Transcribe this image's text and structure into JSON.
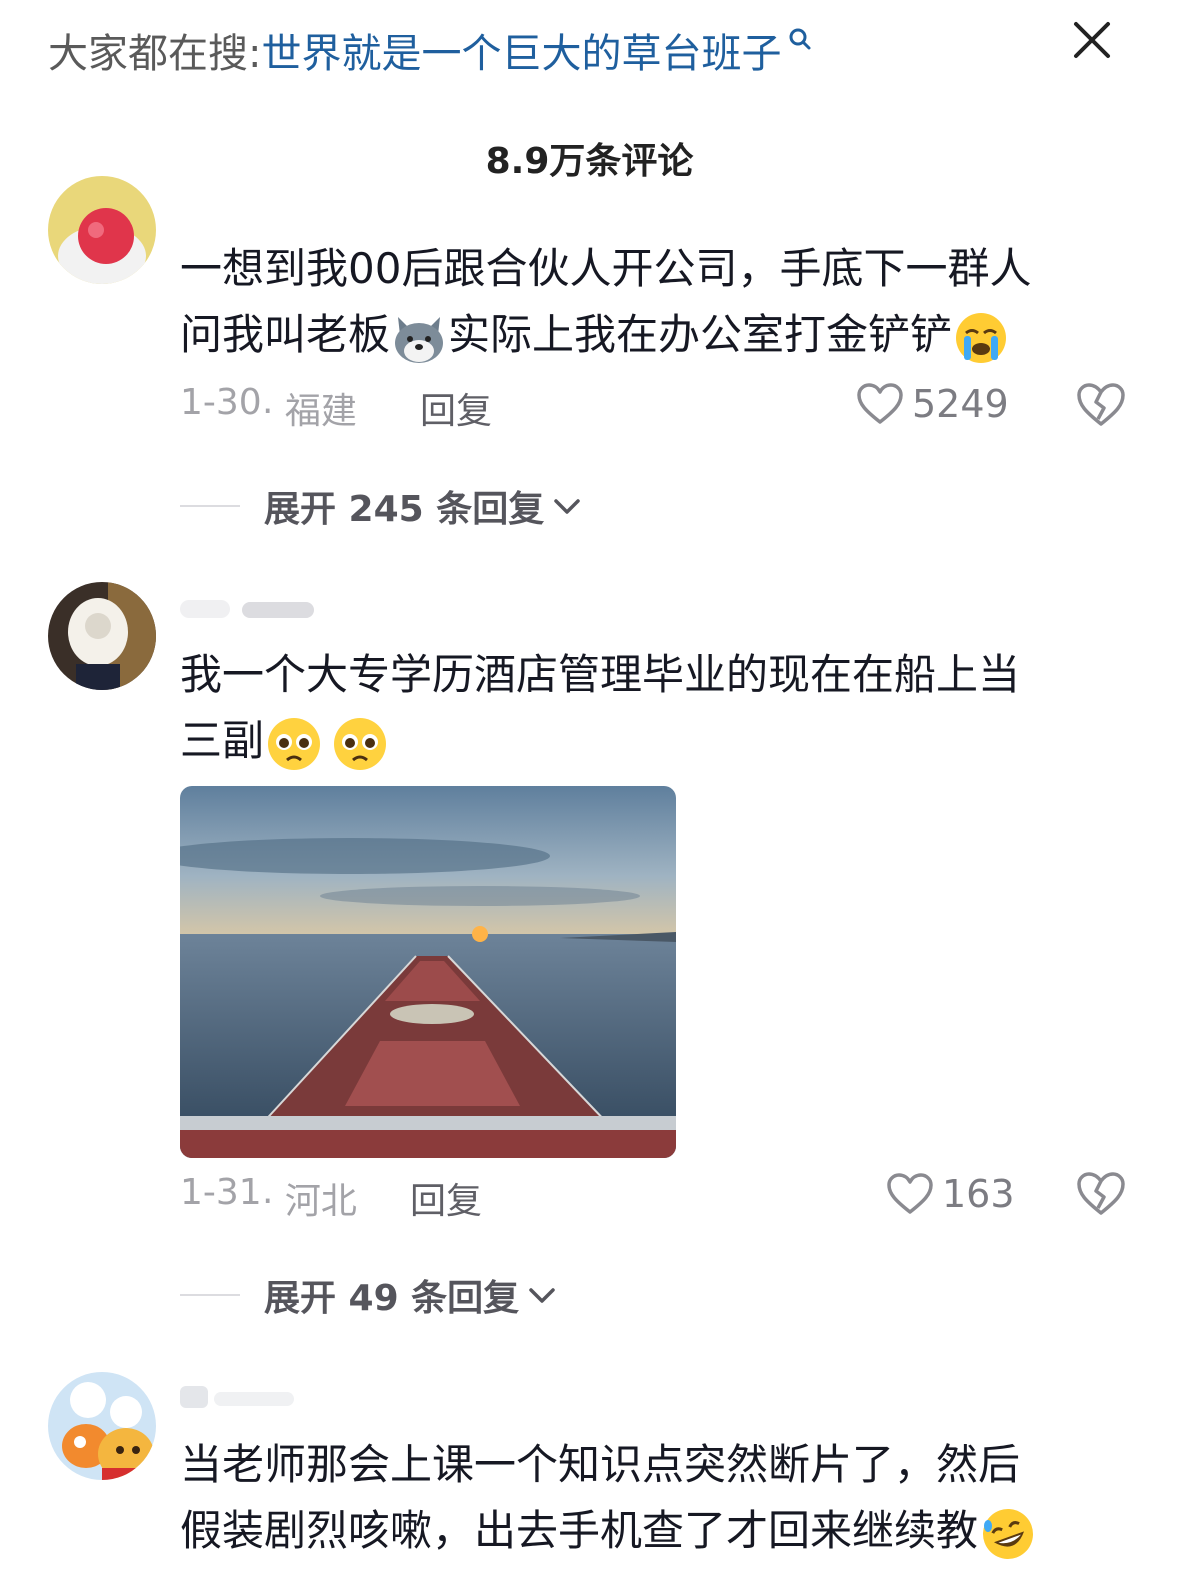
{
  "search": {
    "prefix": "大家都在搜:",
    "term": "世界就是一个巨大的草台班子",
    "search_icon": "search-icon",
    "close_icon": "close-icon"
  },
  "header": {
    "comment_count": "8.9万条评论"
  },
  "comments": [
    {
      "text_line1": "一想到我00后跟合伙人开公司，手底下一群人",
      "text_line2_a": "问我叫老板",
      "text_line2_b": "实际上我在办公室打金铲铲",
      "emojis": [
        "doge-emoji",
        "crying-emoji"
      ],
      "date": "1-30",
      "location": "· 福建",
      "reply_label": "回复",
      "like_count": "5249",
      "expand_label": "展开 245 条回复"
    },
    {
      "text_line1": "我一个大专学历酒店管理毕业的现在在船上当",
      "text_line2": "三副",
      "emojis": [
        "pleading-emoji",
        "pleading-emoji"
      ],
      "image": "ship-deck-sunset-photo",
      "date": "1-31",
      "location": "· 河北",
      "reply_label": "回复",
      "like_count": "163",
      "expand_label": "展开 49 条回复"
    },
    {
      "text_line1": "当老师那会上课一个知识点突然断片了，然后",
      "text_line2": "假装剧烈咳嗽，出去手机查了才回来继续教",
      "emojis": [
        "rofl-emoji"
      ]
    }
  ],
  "colors": {
    "search_term": "#1f5f9e",
    "meta_gray": "#a3a3a8",
    "text": "#161823"
  }
}
